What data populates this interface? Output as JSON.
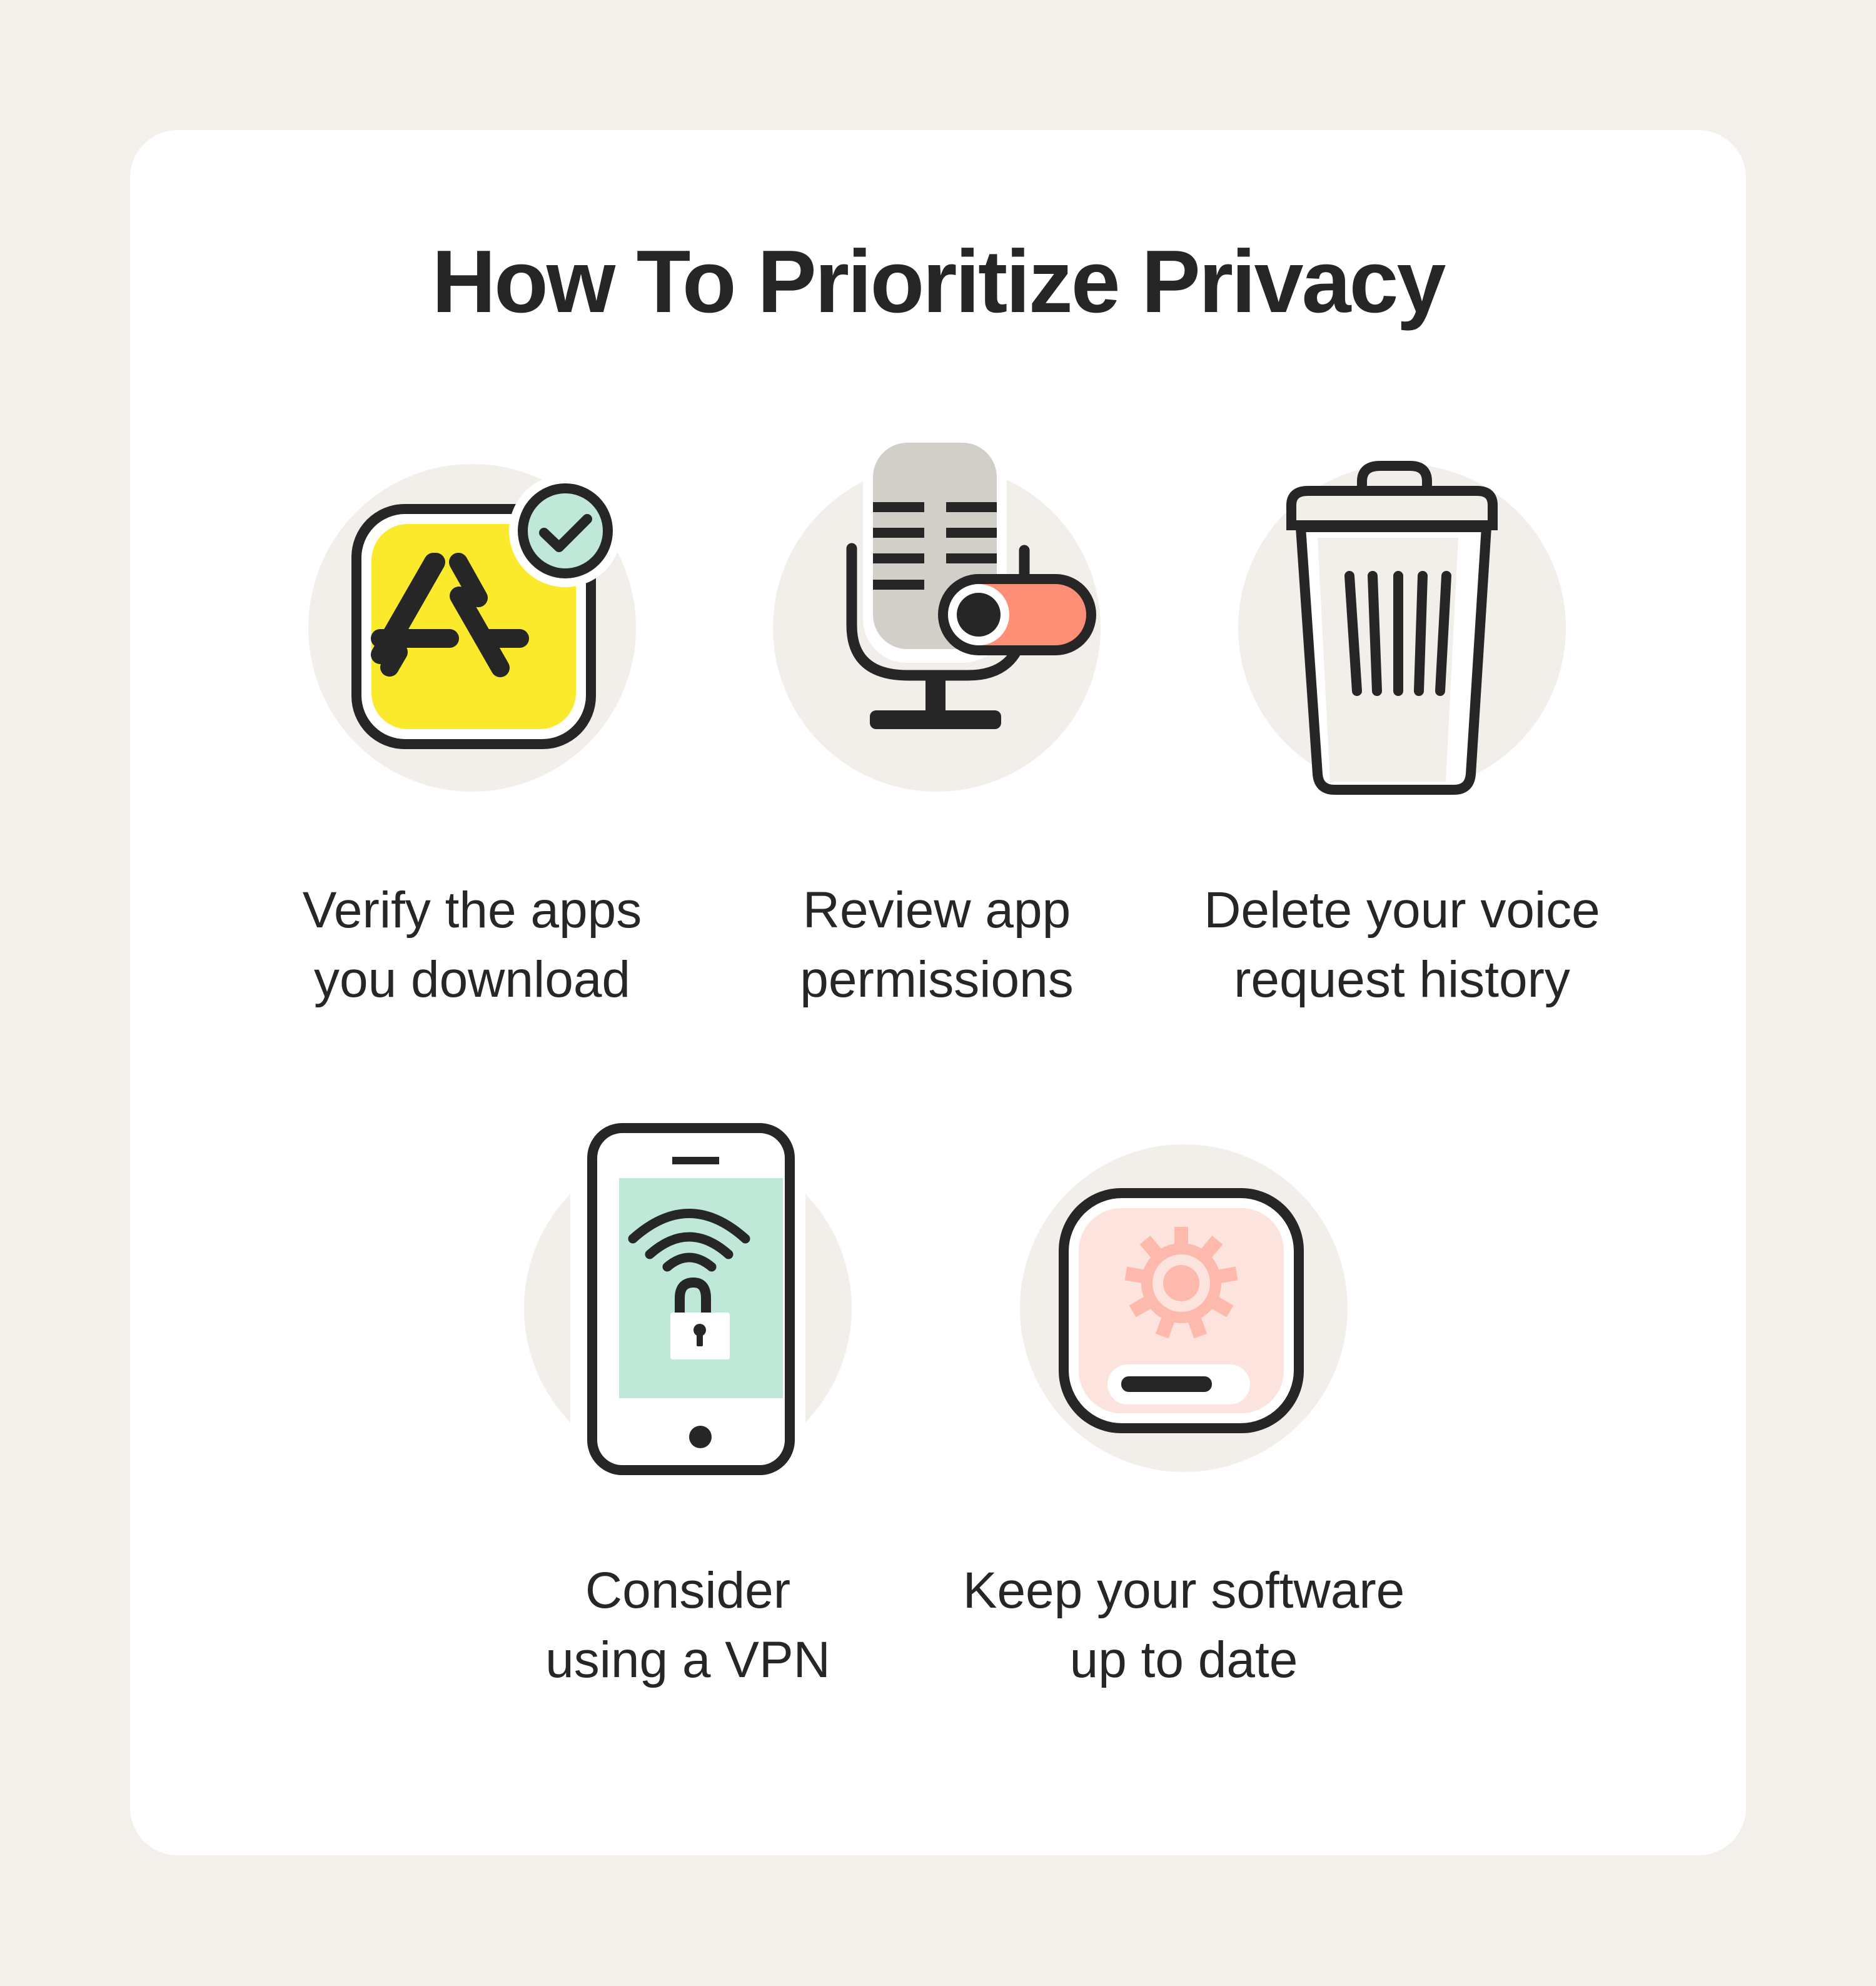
{
  "title": "How To Prioritize Privacy",
  "colors": {
    "page_background": "#f3f0eb",
    "card_background": "#ffffff",
    "icon_circle": "#f2efea",
    "ink": "#262626",
    "yellow": "#fbe92c",
    "mint": "#bfe8d8",
    "coral": "#fd8f76",
    "peach_light": "#fde3dd",
    "peach_gear": "#fdb9ab",
    "mic_gray": "#d2cfc8"
  },
  "tips": [
    {
      "icon": "app-store-check-icon",
      "lines": [
        "Verify the apps",
        "you download"
      ]
    },
    {
      "icon": "microphone-toggle-icon",
      "lines": [
        "Review app",
        "permissions"
      ]
    },
    {
      "icon": "trash-can-icon",
      "lines": [
        "Delete your voice",
        "request history"
      ]
    },
    {
      "icon": "phone-vpn-lock-icon",
      "lines": [
        "Consider",
        "using a VPN"
      ]
    },
    {
      "icon": "software-update-gear-icon",
      "lines": [
        "Keep your software",
        "up to date"
      ]
    }
  ]
}
